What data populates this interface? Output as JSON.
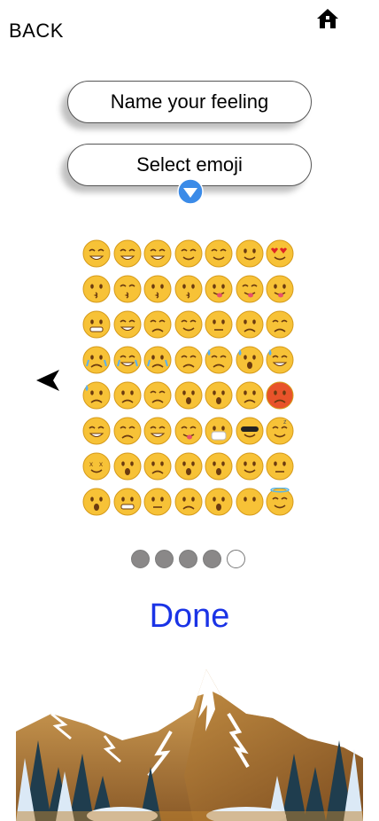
{
  "header": {
    "back_label": "BACK",
    "home_icon": "home-icon"
  },
  "fields": {
    "name_label": "Name your feeling",
    "select_label": "Select emoji",
    "dropdown_icon": "chevron-down-circle-icon"
  },
  "emoji_grid": {
    "rows": [
      [
        "grinning",
        "smiley",
        "grin",
        "blush",
        "relaxed",
        "wink",
        "heart-eyes"
      ],
      [
        "kissing-heart",
        "kissing-closed-eyes",
        "kissing",
        "kissing-smiling-eyes",
        "stuck-out-tongue-winking-eye",
        "stuck-out-tongue-closed-eyes",
        "stuck-out-tongue"
      ],
      [
        "flushed",
        "grin-teeth",
        "pensive",
        "relieved",
        "unamused",
        "disappointed",
        "persevere"
      ],
      [
        "cry",
        "joy",
        "sob",
        "sleepy",
        "disappointed-relieved",
        "cold-sweat",
        "sweat-smile"
      ],
      [
        "sweat",
        "weary",
        "tired-face",
        "fearful",
        "scream",
        "angry",
        "rage"
      ],
      [
        "triumph",
        "confounded",
        "laughing",
        "yum",
        "mask",
        "sunglasses",
        "sleeping"
      ],
      [
        "dizzy-face",
        "astonished",
        "worried",
        "frowning",
        "anguished",
        "smirk",
        "expressionless"
      ],
      [
        "hushed",
        "grimacing",
        "neutral-face",
        "confused",
        "hushed-open",
        "no-mouth",
        "innocent"
      ]
    ]
  },
  "nav": {
    "prev_icon": "arrow-left-icon"
  },
  "pager": {
    "total": 5,
    "active_filled": 4
  },
  "done_label": "Done",
  "colors": {
    "done": "#1a33e6",
    "dropdown": "#3b8be8",
    "emoji_face": "#f7c237"
  }
}
